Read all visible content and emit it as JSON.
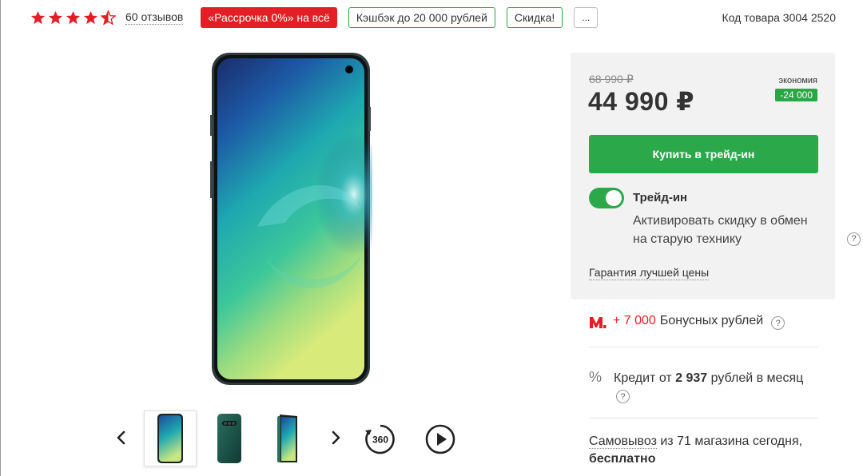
{
  "rating": {
    "value": 4.5,
    "max": 5,
    "reviews_label": "60 отзывов"
  },
  "badges": {
    "installment": "«Рассрочка 0%» на всё",
    "cashback": "Кэшбэк до 20 000 рублей",
    "discount": "Скидка!",
    "more": "..."
  },
  "product_code": "Код товара 3004 2520",
  "price": {
    "old": "68 990 ₽",
    "current": "44 990 ₽",
    "economy_label": "экономия",
    "economy_value": "-24 000"
  },
  "buy_button": "Купить в трейд-ин",
  "tradein": {
    "enabled": true,
    "title": "Трейд-ин",
    "description": "Активировать скидку в обмен на старую технику"
  },
  "best_price_label": "Гарантия лучшей цены",
  "bonus": {
    "amount": "+ 7 000",
    "text": "Бонусных рублей"
  },
  "credit": {
    "prefix": "Кредит от",
    "amount": "2 937",
    "suffix": "рублей в месяц"
  },
  "pickup": {
    "link": "Самовывоз",
    "text": "из 71 магазина сегодня,",
    "free": "бесплатно"
  },
  "gallery": {
    "thumbnails": 3,
    "active_index": 0,
    "view360_label": "360"
  },
  "colors": {
    "accent_red": "#e31e24",
    "accent_green": "#2aa84a",
    "card_bg": "#f2f2f2"
  }
}
